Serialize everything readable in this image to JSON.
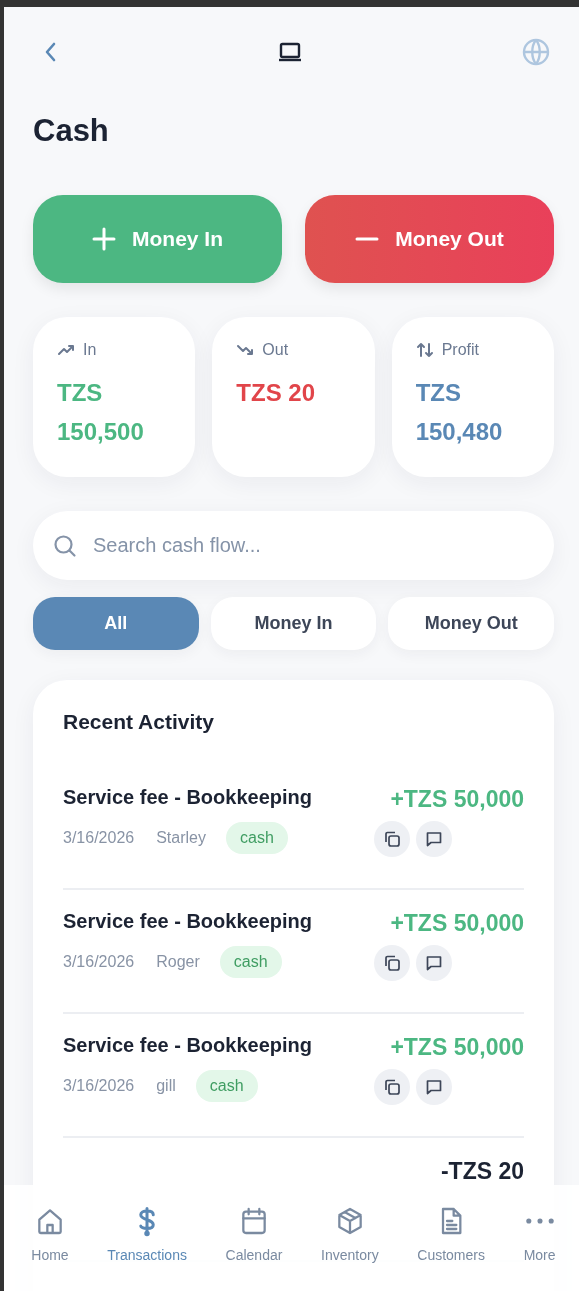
{
  "header": {
    "title": "Cash"
  },
  "actions": [
    {
      "kind": "in",
      "label": "Money In"
    },
    {
      "kind": "out",
      "label": "Money Out"
    }
  ],
  "stats": [
    {
      "kind": "in",
      "label": "In",
      "value": "TZS 150,500"
    },
    {
      "kind": "out",
      "label": "Out",
      "value": "TZS 20"
    },
    {
      "kind": "profit",
      "label": "Profit",
      "value": "TZS 150,480"
    }
  ],
  "search": {
    "placeholder": "Search cash flow..."
  },
  "filters": [
    {
      "label": "All",
      "selected": true
    },
    {
      "label": "Money In",
      "selected": false
    },
    {
      "label": "Money Out",
      "selected": false
    }
  ],
  "activity": {
    "title": "Recent Activity",
    "items": [
      {
        "kind": "in",
        "title": "Service fee - Bookkeeping",
        "date": "3/16/2026",
        "person": "Starley",
        "tag": "cash",
        "amount": "+TZS 50,000"
      },
      {
        "kind": "in",
        "title": "Service fee - Bookkeeping",
        "date": "3/16/2026",
        "person": "Roger",
        "tag": "cash",
        "amount": "+TZS 50,000"
      },
      {
        "kind": "in",
        "title": "Service fee - Bookkeeping",
        "date": "3/16/2026",
        "person": "gill",
        "tag": "cash",
        "amount": "+TZS 50,000"
      },
      {
        "kind": "out",
        "amount": "-TZS 20"
      }
    ]
  },
  "nav": [
    {
      "kind": "home",
      "label": "Home",
      "selected": false
    },
    {
      "kind": "transactions",
      "label": "Transactions",
      "selected": true
    },
    {
      "kind": "calendar",
      "label": "Calendar",
      "selected": false
    },
    {
      "kind": "inventory",
      "label": "Inventory",
      "selected": false
    },
    {
      "kind": "customers",
      "label": "Customers",
      "selected": false
    },
    {
      "kind": "more",
      "label": "More",
      "selected": false
    }
  ]
}
